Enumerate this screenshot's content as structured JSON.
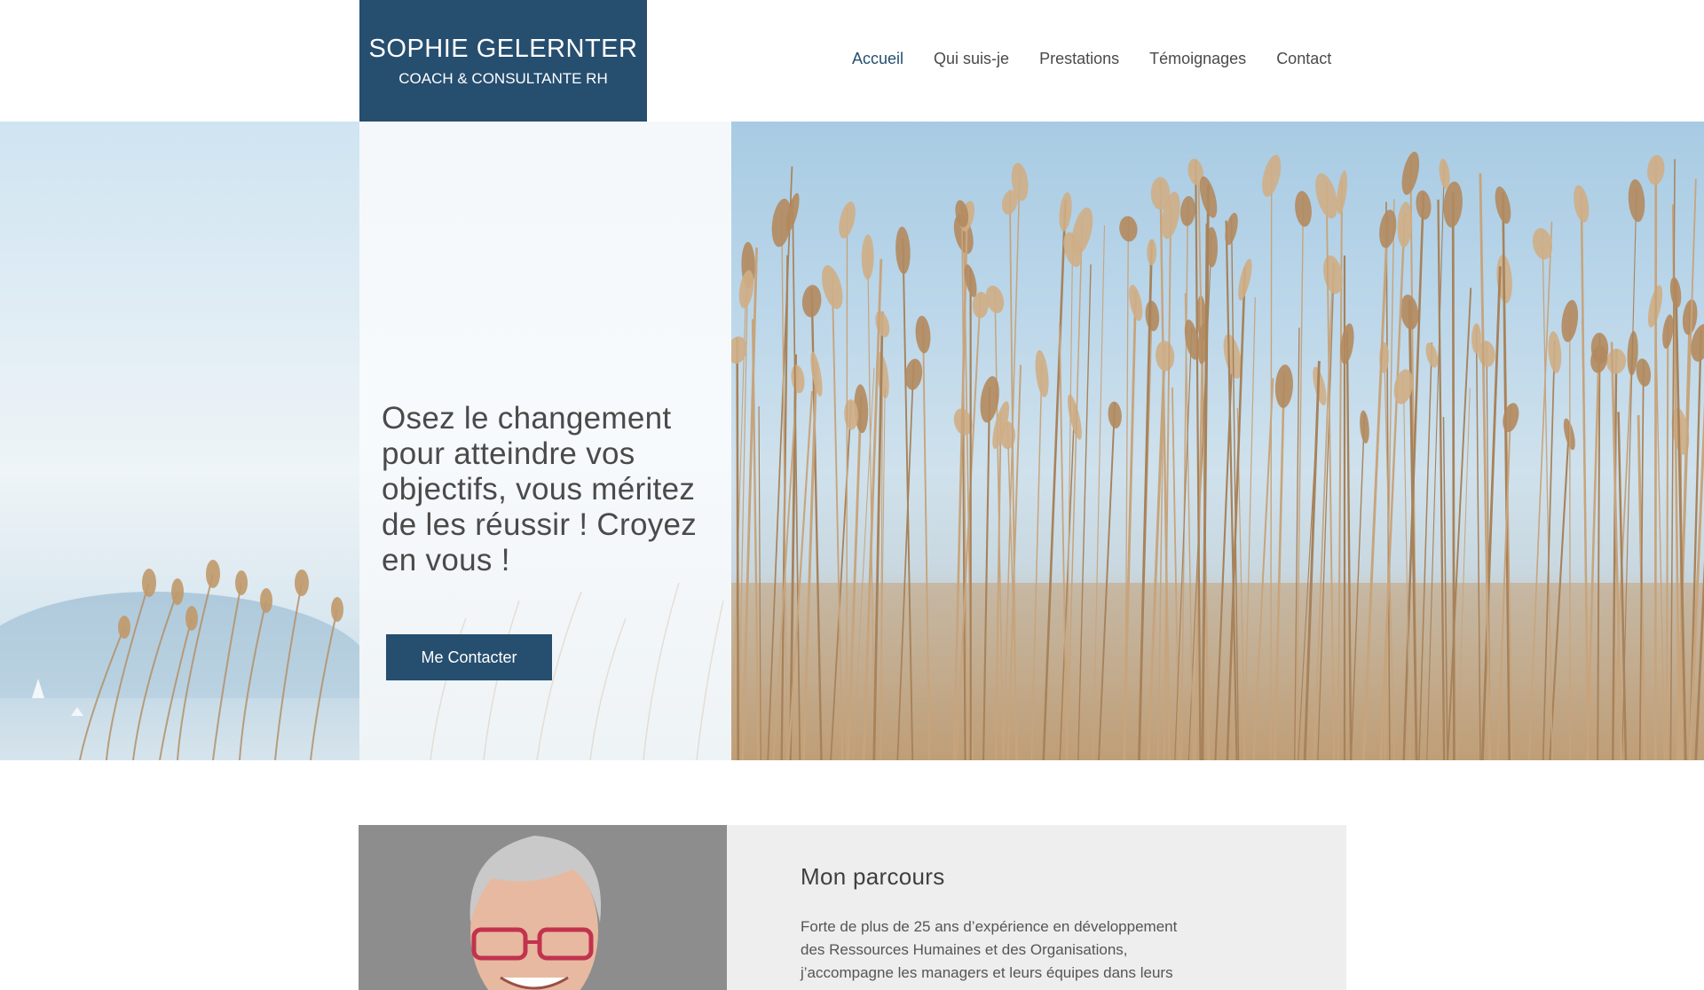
{
  "brand": {
    "name": "SOPHIE GELERNTER",
    "tagline": "COACH & CONSULTANTE RH",
    "primary_color": "#264e6f"
  },
  "nav": {
    "items": [
      {
        "label": "Accueil",
        "active": true
      },
      {
        "label": "Qui suis-je",
        "active": false
      },
      {
        "label": "Prestations",
        "active": false
      },
      {
        "label": "Témoignages",
        "active": false
      },
      {
        "label": "Contact",
        "active": false
      }
    ]
  },
  "hero": {
    "headline": "Osez le changement pour atteindre vos objectifs, vous méritez de les réussir ! Croyez en vous !",
    "cta_label": "Me Contacter"
  },
  "about": {
    "title": "Mon parcours",
    "body": "Forte de plus de 25 ans d’expérience en développement des Ressources Humaines et des Organisations, j’accompagne les managers et leurs équipes dans leurs problématiques RH et"
  }
}
